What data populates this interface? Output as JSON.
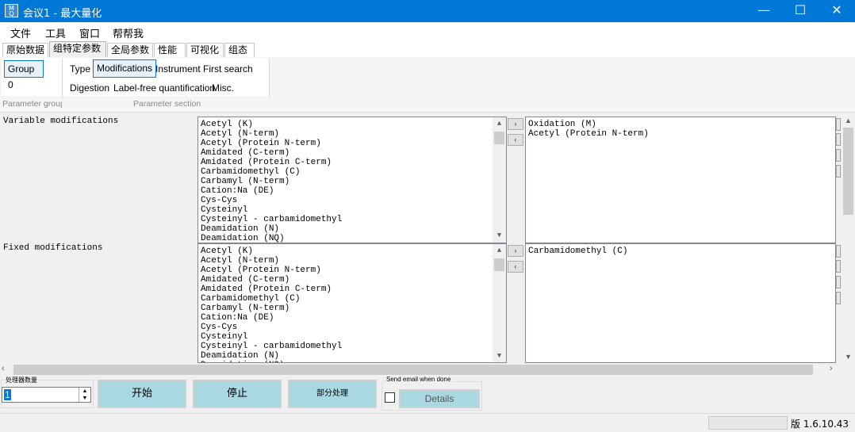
{
  "window": {
    "icon_text": "M Q",
    "title": "会议1 - 最大量化",
    "minimize_glyph": "—",
    "maximize_glyph": "☐",
    "close_glyph": "✕"
  },
  "menu": [
    "文件",
    "工具",
    "窗口",
    "帮帮我"
  ],
  "tabs": [
    "原始数据",
    "组特定参数",
    "全局参数",
    "性能",
    "可视化",
    "组态"
  ],
  "active_tab": "组特定参数",
  "ribbon": {
    "group_button": "Group 0",
    "group_label": "Parameter group",
    "section_row1": [
      "Type",
      "Modifications",
      "Instrument",
      "First search"
    ],
    "section_row2": [
      "Digestion",
      "Label-free quantification",
      "Misc."
    ],
    "selected": "Modifications",
    "section_label": "Parameter section"
  },
  "variable": {
    "label": "Variable modifications",
    "available": [
      "Acetyl (K)",
      "Acetyl (N-term)",
      "Acetyl (Protein N-term)",
      "Amidated (C-term)",
      "Amidated (Protein C-term)",
      "Carbamidomethyl (C)",
      "Carbamyl (N-term)",
      "Cation:Na (DE)",
      "Cys-Cys",
      "Cysteinyl",
      "Cysteinyl - carbamidomethyl",
      "Deamidation (N)",
      "Deamidation (NQ)"
    ],
    "selected": [
      "Oxidation (M)",
      "Acetyl (Protein N-term)"
    ]
  },
  "fixed": {
    "label": "Fixed modifications",
    "available": [
      "Acetyl (K)",
      "Acetyl (N-term)",
      "Acetyl (Protein N-term)",
      "Amidated (C-term)",
      "Amidated (Protein C-term)",
      "Carbamidomethyl (C)",
      "Carbamyl (N-term)",
      "Cation:Na (DE)",
      "Cys-Cys",
      "Cysteinyl",
      "Cysteinyl - carbamidomethyl",
      "Deamidation (N)",
      "Deamidation (NQ)"
    ],
    "selected": [
      "Carbamidomethyl (C)"
    ]
  },
  "move_right": "›",
  "move_left": "‹",
  "bottom": {
    "processors_label": "处理器数量",
    "processors_value": "1",
    "start": "开始",
    "stop": "停止",
    "partial": "部分处理",
    "email_label": "Send email when done",
    "details": "Details"
  },
  "status": {
    "version": "版 1.6.10.43"
  }
}
